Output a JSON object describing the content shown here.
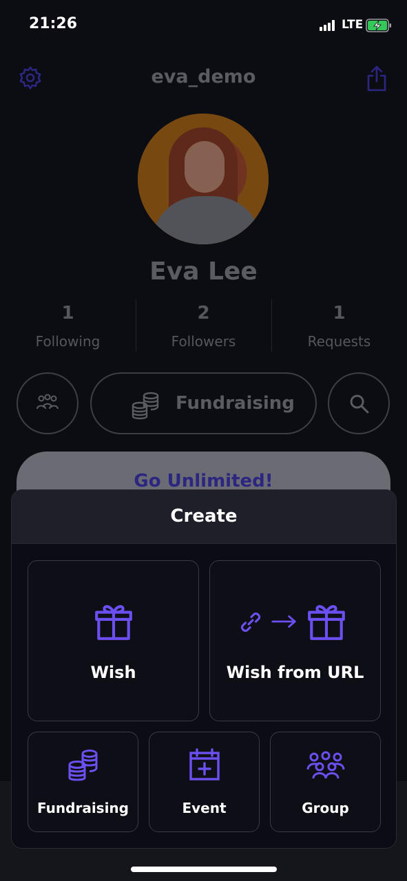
{
  "status_bar": {
    "time": "21:26",
    "network": "LTE"
  },
  "header": {
    "username": "eva_demo"
  },
  "profile": {
    "name": "Eva Lee",
    "stats": [
      {
        "value": "1",
        "label": "Following"
      },
      {
        "value": "2",
        "label": "Followers"
      },
      {
        "value": "1",
        "label": "Requests"
      }
    ],
    "fundraising_label": "Fundraising",
    "promo_label": "Go Unlimited!"
  },
  "sheet": {
    "title": "Create",
    "options": {
      "wish": "Wish",
      "wish_url": "Wish from URL",
      "fundraising": "Fundraising",
      "event": "Event",
      "group": "Group"
    }
  },
  "colors": {
    "accent": "#6c4ff0",
    "background": "#0c0d13",
    "sheet_header": "#1e1f29"
  }
}
